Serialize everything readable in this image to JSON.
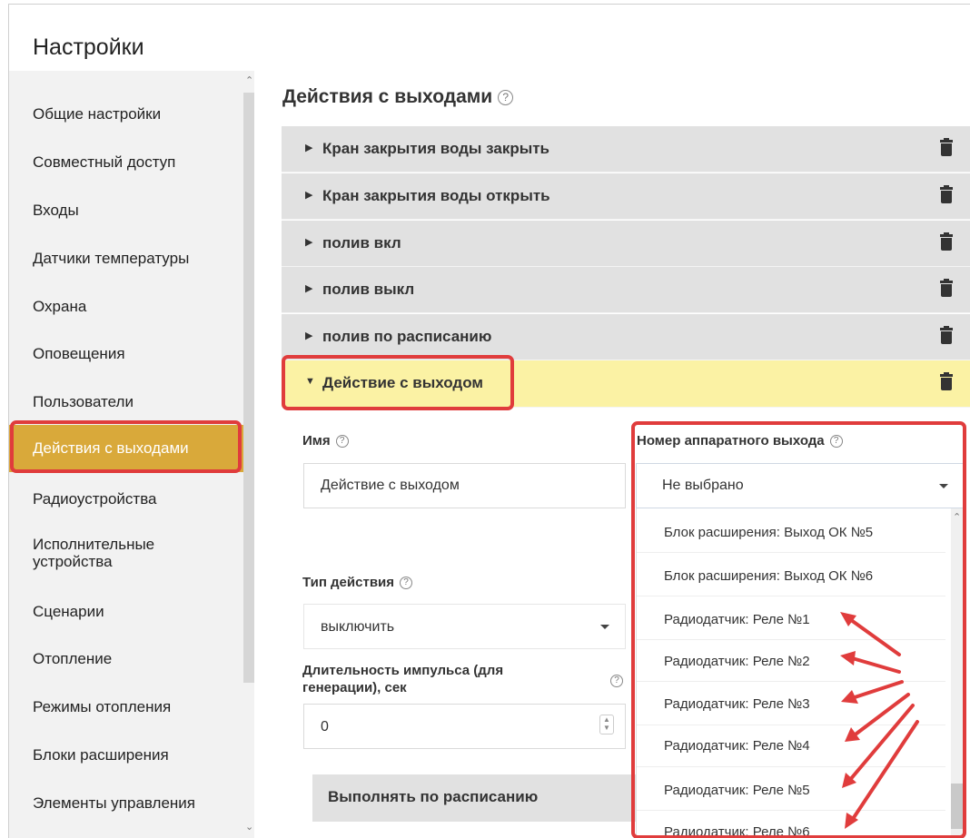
{
  "app": {
    "title": "Настройки"
  },
  "sidebar": {
    "items": [
      {
        "label": "Общие настройки"
      },
      {
        "label": "Совместный доступ"
      },
      {
        "label": "Входы"
      },
      {
        "label": "Датчики температуры"
      },
      {
        "label": "Охрана"
      },
      {
        "label": "Оповещения"
      },
      {
        "label": "Пользователи"
      },
      {
        "label": "Действия с выходами",
        "active": true
      },
      {
        "label": "Радиоустройства"
      },
      {
        "label": "Исполнительные",
        "label2": "устройства"
      },
      {
        "label": "Сценарии"
      },
      {
        "label": "Отопление"
      },
      {
        "label": "Режимы отопления"
      },
      {
        "label": "Блоки расширения"
      },
      {
        "label": "Элементы управления"
      }
    ]
  },
  "main": {
    "title": "Действия с выходами",
    "help_icon": "?",
    "actions": [
      {
        "label": "Кран закрытия воды закрыть"
      },
      {
        "label": "Кран закрытия воды открыть"
      },
      {
        "label": "полив вкл"
      },
      {
        "label": "полив выкл"
      },
      {
        "label": "полив по расписанию"
      },
      {
        "label": "Действие с выходом",
        "expanded": true
      }
    ]
  },
  "form": {
    "name_label": "Имя",
    "name_value": "Действие с выходом",
    "action_type_label": "Тип действия",
    "action_type_value": "выключить",
    "pulse_label_line1": "Длительность импульса (для",
    "pulse_label_line2": "генерации), сек",
    "pulse_value": "0",
    "schedule_label": "Выполнять по расписанию",
    "output_label": "Номер аппаратного выхода",
    "output_value": "Не выбрано",
    "output_options": [
      "Блок расширения: Выход ОК №5",
      "Блок расширения: Выход ОК №6",
      "Радиодатчик: Реле №1",
      "Радиодатчик: Реле №2",
      "Радиодатчик: Реле №3",
      "Радиодатчик: Реле №4",
      "Радиодатчик: Реле №5",
      "Радиодатчик: Реле №6"
    ]
  },
  "colors": {
    "active_sidebar": "#d9a93a",
    "highlight_border": "#e03c3c",
    "expanded_row": "#fbf2a4",
    "collapsed_row": "#e1e1e1"
  },
  "icons": {
    "expand": "triangle-right-icon",
    "collapse": "triangle-down-icon",
    "delete": "trash-icon",
    "help": "question-circle-icon",
    "arrows": "red-arrow-icon"
  }
}
